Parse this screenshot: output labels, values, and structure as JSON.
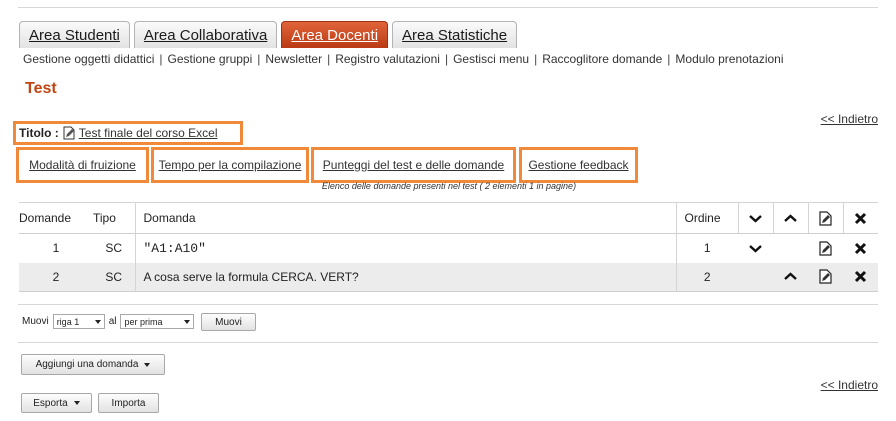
{
  "tabs": [
    {
      "label": "Area Studenti",
      "active": false
    },
    {
      "label": "Area Collaborativa",
      "active": false
    },
    {
      "label": "Area Docenti",
      "active": true
    },
    {
      "label": "Area Statistiche",
      "active": false
    }
  ],
  "subnav": [
    "Gestione oggetti didattici",
    "Gestione gruppi",
    "Newsletter",
    "Registro valutazioni",
    "Gestisci menu",
    "Raccoglitore domande",
    "Modulo prenotazioni"
  ],
  "page_title": "Test",
  "back_link": "<< Indietro",
  "titolo": {
    "label": "Titolo :",
    "value": "Test finale del corso Excel",
    "icon": "edit-document-icon"
  },
  "options": {
    "fruizione": "Modalità di fruizione",
    "tempo": "Tempo per la compilazione",
    "punteggi": "Punteggi del test e delle domande",
    "feedback": "Gestione feedback"
  },
  "caption": "Elenco delle domande presenti nel test ( 2 elementi 1 in pagine)",
  "table": {
    "headers": {
      "domande": "Domande",
      "tipo": "Tipo",
      "domanda": "Domanda",
      "ordine": "Ordine"
    },
    "rows": [
      {
        "num": "1",
        "tipo": "SC",
        "domanda": "\"A1:A10\"",
        "ordine": "1"
      },
      {
        "num": "2",
        "tipo": "SC",
        "domanda": "A cosa serve la formula CERCA. VERT?",
        "ordine": "2"
      }
    ]
  },
  "move": {
    "label_muovi": "Muovi",
    "row_select": "riga 1",
    "label_al": "al",
    "position_select": "per prima",
    "button": "Muovi"
  },
  "buttons": {
    "aggiungi": "Aggiungi una domanda",
    "esporta": "Esporta",
    "importa": "Importa"
  },
  "colors": {
    "accent": "#c24512",
    "highlight": "#f08a3a",
    "active_tab": "#c9481d"
  }
}
